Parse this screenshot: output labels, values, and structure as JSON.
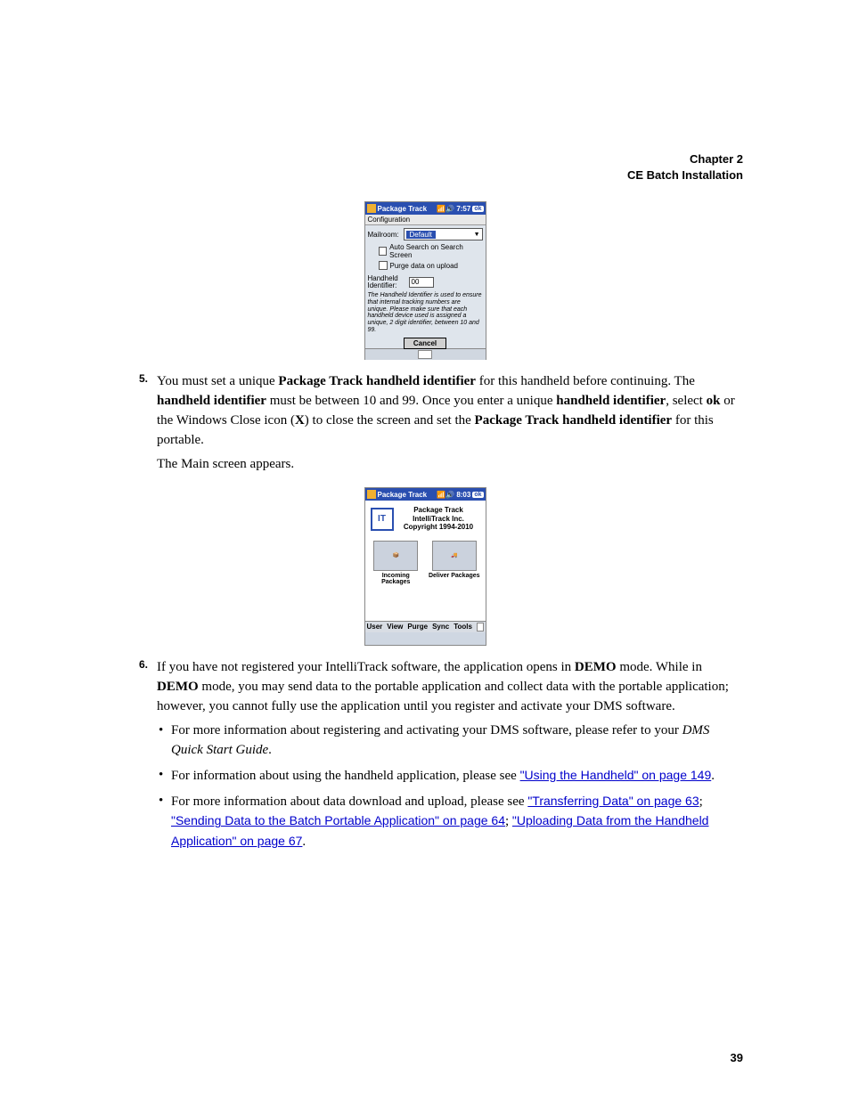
{
  "header": {
    "line1": "Chapter 2",
    "line2": "CE Batch Installation"
  },
  "page_number": "39",
  "shot1": {
    "title": "Package Track",
    "time": "7:57",
    "ok": "ok",
    "subtitle": "Configuration",
    "mailroom_label": "Mailroom:",
    "mailroom_value": "Default",
    "auto_search": "Auto Search on Search Screen",
    "purge": "Purge data on upload",
    "hh_label": "Handheld Identifier:",
    "hh_value": "00",
    "note": "The Handheld Identifier is used to ensure that internal tracking numbers are unique. Please make sure that each handheld device used is assigned a unique, 2 digit identifier, between 10 and 99.",
    "cancel": "Cancel"
  },
  "step5": {
    "num": "5.",
    "t1": "You must set a unique ",
    "b1": "Package Track handheld identifier",
    "t2": " for this handheld before continuing. The ",
    "b2": "handheld identifier",
    "t3": " must be between 10 and 99. Once you enter a unique ",
    "b3": "handheld identifier",
    "t4": ", select ",
    "b4": "ok",
    "t5": " or the Windows Close icon (",
    "b5": "X",
    "t6": ") to close the screen and set the ",
    "b6": "Package Track handheld identifier",
    "t7": " for this portable.",
    "p2": "The Main screen appears."
  },
  "shot2": {
    "title": "Package Track",
    "time": "8:03",
    "ok": "ok",
    "logo": "IT",
    "line1": "Package Track",
    "line2": "IntelliTrack Inc.",
    "line3": "Copyright 1994-2010",
    "btn1": "Incoming Packages",
    "btn2": "Deliver Packages",
    "menu": [
      "User",
      "View",
      "Purge",
      "Sync",
      "Tools"
    ]
  },
  "step6": {
    "num": "6.",
    "t1": "If you have not registered your IntelliTrack software, the application opens in ",
    "b1": "DEMO",
    "t2": " mode. While in ",
    "b2": "DEMO",
    "t3": " mode, you may send data to the portable application and collect data with the portable application; however, you cannot fully use the application until you register and activate your DMS software.",
    "bul1a": "For more information about registering and activating your DMS software, please refer to your ",
    "bul1i": "DMS Quick Start Guide",
    "bul1b": ".",
    "bul2a": "For information about using the handheld application, please see ",
    "bul2l": "\"Using the Handheld\" on page 149",
    "bul2b": ".",
    "bul3a": "For more information about data download and upload, please see ",
    "bul3l1": "\"Transferring Data\" on page 63",
    "bul3s1": "; ",
    "bul3l2": "\"Sending Data to the Batch Portable Application\" on page 64",
    "bul3s2": "; ",
    "bul3l3": "\"Uploading Data from the Handheld Application\" on page 67",
    "bul3b": "."
  }
}
